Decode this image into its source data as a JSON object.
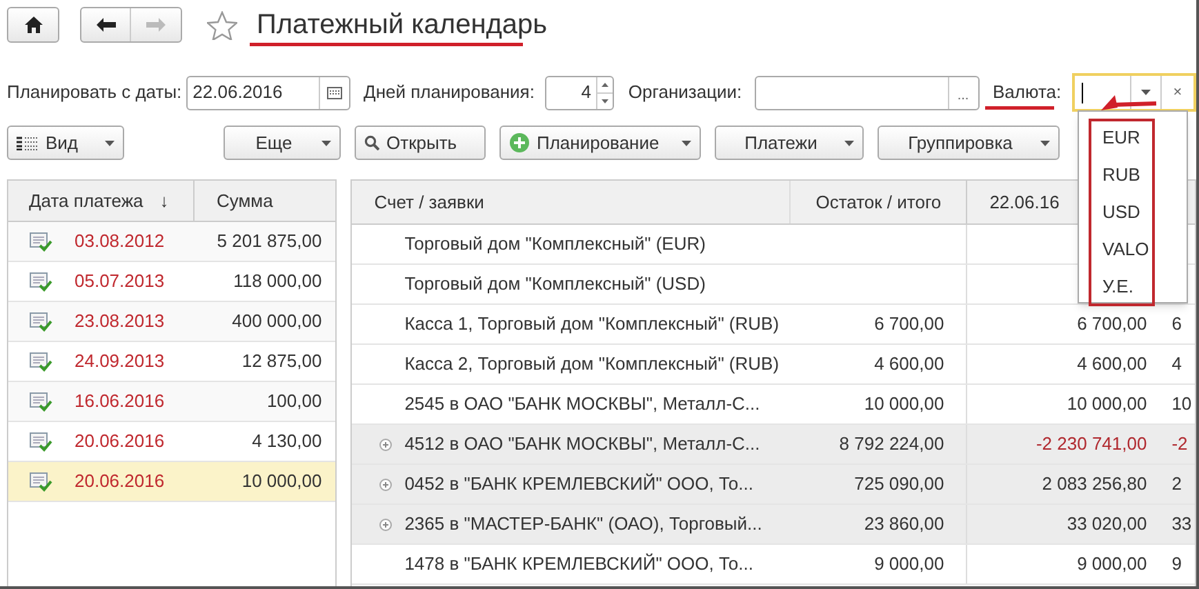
{
  "title": "Платежный календарь",
  "filters": [
    {
      "kind": "date",
      "label": "Планировать с даты:",
      "value": "22.06.2016"
    },
    {
      "kind": "spin",
      "label": "Дней планирования:",
      "value": "4"
    },
    {
      "kind": "select",
      "label": "Организации:",
      "button": "..."
    },
    {
      "kind": "currency",
      "label": "Валюта:",
      "clear": "×"
    }
  ],
  "toolbar": [
    {
      "kind": "view",
      "label": "Вид",
      "dropdown": true
    },
    {
      "kind": "plain",
      "label": "Еще",
      "dropdown": true
    },
    {
      "kind": "search",
      "label": "Открыть",
      "dropdown": false
    },
    {
      "kind": "add",
      "label": "Планирование",
      "dropdown": true
    },
    {
      "kind": "plain",
      "label": "Платежи",
      "dropdown": true
    },
    {
      "kind": "plain",
      "label": "Группировка",
      "dropdown": true
    }
  ],
  "payments": {
    "columns": [
      "Дата платежа",
      "Сумма"
    ],
    "sort_indicator": "↓",
    "rows": [
      {
        "date": "03.08.2012",
        "amount": "5 201 875,00",
        "overdue": true,
        "selected": false
      },
      {
        "date": "05.07.2013",
        "amount": "118 000,00",
        "overdue": true,
        "selected": false
      },
      {
        "date": "23.08.2013",
        "amount": "400 000,00",
        "overdue": true,
        "selected": false
      },
      {
        "date": "24.09.2013",
        "amount": "12 875,00",
        "overdue": true,
        "selected": false
      },
      {
        "date": "16.06.2016",
        "amount": "100,00",
        "overdue": true,
        "selected": false
      },
      {
        "date": "20.06.2016",
        "amount": "4 130,00",
        "overdue": true,
        "selected": false
      },
      {
        "date": "20.06.2016",
        "amount": "10 000,00",
        "overdue": true,
        "selected": true
      }
    ]
  },
  "accounts": {
    "columns": [
      "Счет / заявки",
      "Остаток / итого",
      "22.06.16"
    ],
    "rows": [
      {
        "account": "Торговый дом \"Комплексный\" (EUR)",
        "expandable": false
      },
      {
        "account": "Торговый дом \"Комплексный\" (USD)",
        "expandable": false
      },
      {
        "account": "Касса 1, Торговый дом \"Комплексный\" (RUB)",
        "balance": "6 700,00",
        "day_1": "6 700,00",
        "column_4": "6",
        "expandable": false,
        "negative": false
      },
      {
        "account": "Касса 2, Торговый дом \"Комплексный\" (RUB)",
        "balance": "4 600,00",
        "day_1": "4 600,00",
        "column_4": "4",
        "expandable": false,
        "negative": false
      },
      {
        "account": "2545 в ОАО \"БАНК МОСКВЫ\", Металл-С...",
        "balance": "10 000,00",
        "day_1": "10 000,00",
        "column_4": "10",
        "expandable": false,
        "negative": false
      },
      {
        "account": "4512 в ОАО \"БАНК МОСКВЫ\", Металл-С...",
        "balance": "8 792 224,00",
        "day_1": "-2 230 741,00",
        "column_4": "-2",
        "expandable": true,
        "negative": true
      },
      {
        "account": "0452 в \"БАНК КРЕМЛЕВСКИЙ\" ООО, То...",
        "balance": "725 090,00",
        "day_1": "2 083 256,80",
        "column_4": "2",
        "expandable": true,
        "negative": false
      },
      {
        "account": "2365 в \"МАСТЕР-БАНК\" (ОАО), Торговый...",
        "balance": "23 860,00",
        "day_1": "33 020,00",
        "column_4": "33",
        "expandable": true,
        "negative": false
      },
      {
        "account": "1478 в \"БАНК КРЕМЛЕВСКИЙ\" ООО, То...",
        "balance": "9 000,00",
        "day_1": "9 000,00",
        "column_4": "9",
        "expandable": false,
        "negative": false
      }
    ]
  },
  "currency_dropdown": {
    "items": [
      {
        "label": "EUR"
      },
      {
        "label": "RUB"
      },
      {
        "label": "USD"
      },
      {
        "label": "VALO"
      },
      {
        "label": "У.Е."
      }
    ]
  }
}
